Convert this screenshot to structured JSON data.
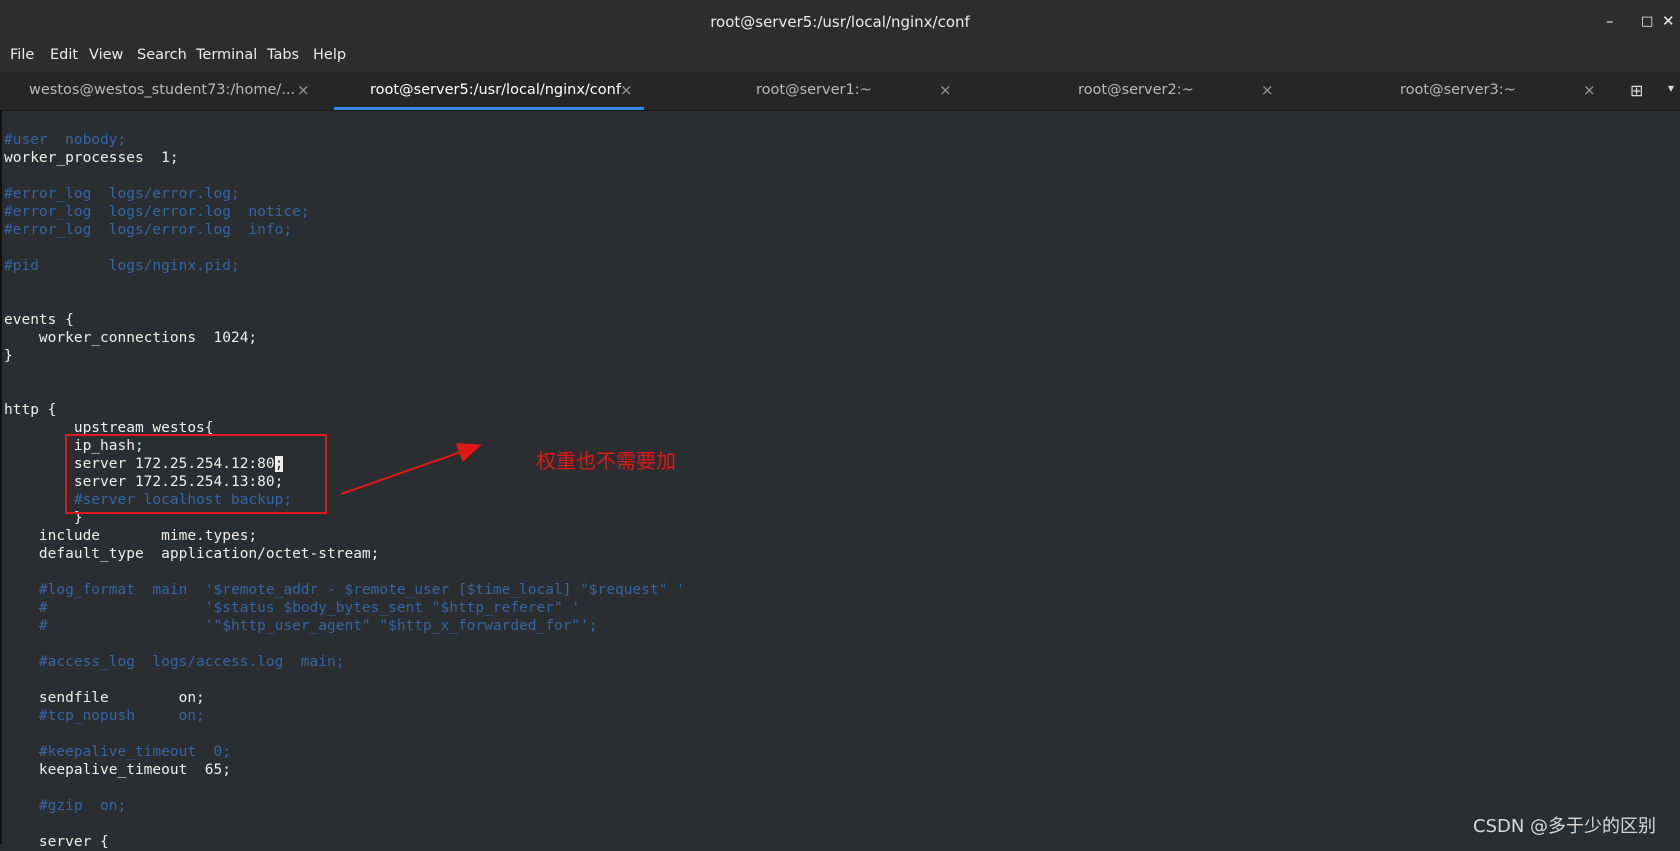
{
  "window": {
    "title": "root@server5:/usr/local/nginx/conf",
    "minimize": "–",
    "maximize": "□",
    "close": "✕"
  },
  "menu": [
    "File",
    "Edit",
    "View",
    "Search",
    "Terminal",
    "Tabs",
    "Help"
  ],
  "tabs": [
    {
      "label": "westos@westos_student73:/home/...",
      "active": false
    },
    {
      "label": "root@server5:/usr/local/nginx/conf",
      "active": true
    },
    {
      "label": "root@server1:~",
      "active": false
    },
    {
      "label": "root@server2:~",
      "active": false
    },
    {
      "label": "root@server3:~",
      "active": false
    }
  ],
  "terminal_lines": [
    {
      "text": "#user  nobody;",
      "comment": true
    },
    {
      "text": "worker_processes  1;",
      "comment": false
    },
    {
      "text": "",
      "comment": false
    },
    {
      "text": "#error_log  logs/error.log;",
      "comment": true
    },
    {
      "text": "#error_log  logs/error.log  notice;",
      "comment": true
    },
    {
      "text": "#error_log  logs/error.log  info;",
      "comment": true
    },
    {
      "text": "",
      "comment": false
    },
    {
      "text": "#pid        logs/nginx.pid;",
      "comment": true
    },
    {
      "text": "",
      "comment": false
    },
    {
      "text": "",
      "comment": false
    },
    {
      "text": "events {",
      "comment": false
    },
    {
      "text": "    worker_connections  1024;",
      "comment": false
    },
    {
      "text": "}",
      "comment": false
    },
    {
      "text": "",
      "comment": false
    },
    {
      "text": "",
      "comment": false
    },
    {
      "text": "http {",
      "comment": false
    },
    {
      "text": "        upstream westos{",
      "comment": false
    },
    {
      "text": "        ip_hash;",
      "comment": false
    },
    {
      "text": "        server 172.25.254.12:80",
      "comment": false,
      "cursor": ";"
    },
    {
      "text": "        server 172.25.254.13:80;",
      "comment": false
    },
    {
      "text": "        #server localhost backup;",
      "comment": true
    },
    {
      "text": "        }",
      "comment": false
    },
    {
      "text": "    include       mime.types;",
      "comment": false
    },
    {
      "text": "    default_type  application/octet-stream;",
      "comment": false
    },
    {
      "text": "",
      "comment": false
    },
    {
      "text": "    #log_format  main  '$remote_addr - $remote_user [$time_local] \"$request\" '",
      "comment": true
    },
    {
      "text": "    #                  '$status $body_bytes_sent \"$http_referer\" '",
      "comment": true
    },
    {
      "text": "    #                  '\"$http_user_agent\" \"$http_x_forwarded_for\"';",
      "comment": true
    },
    {
      "text": "",
      "comment": false
    },
    {
      "text": "    #access_log  logs/access.log  main;",
      "comment": true
    },
    {
      "text": "",
      "comment": false
    },
    {
      "text": "    sendfile        on;",
      "comment": false
    },
    {
      "text": "    #tcp_nopush     on;",
      "comment": true
    },
    {
      "text": "",
      "comment": false
    },
    {
      "text": "    #keepalive_timeout  0;",
      "comment": true
    },
    {
      "text": "    keepalive_timeout  65;",
      "comment": false
    },
    {
      "text": "",
      "comment": false
    },
    {
      "text": "    #gzip  on;",
      "comment": true
    },
    {
      "text": "",
      "comment": false
    },
    {
      "text": "    server {",
      "comment": false
    }
  ],
  "annotation": {
    "text": "权重也不需要加",
    "color": "#e01818"
  },
  "watermark": "CSDN @多于少的区别",
  "colors": {
    "comment": "#3465a4",
    "text": "#eeeeec",
    "background": "#2b2e31",
    "accent": "#3584e4"
  }
}
